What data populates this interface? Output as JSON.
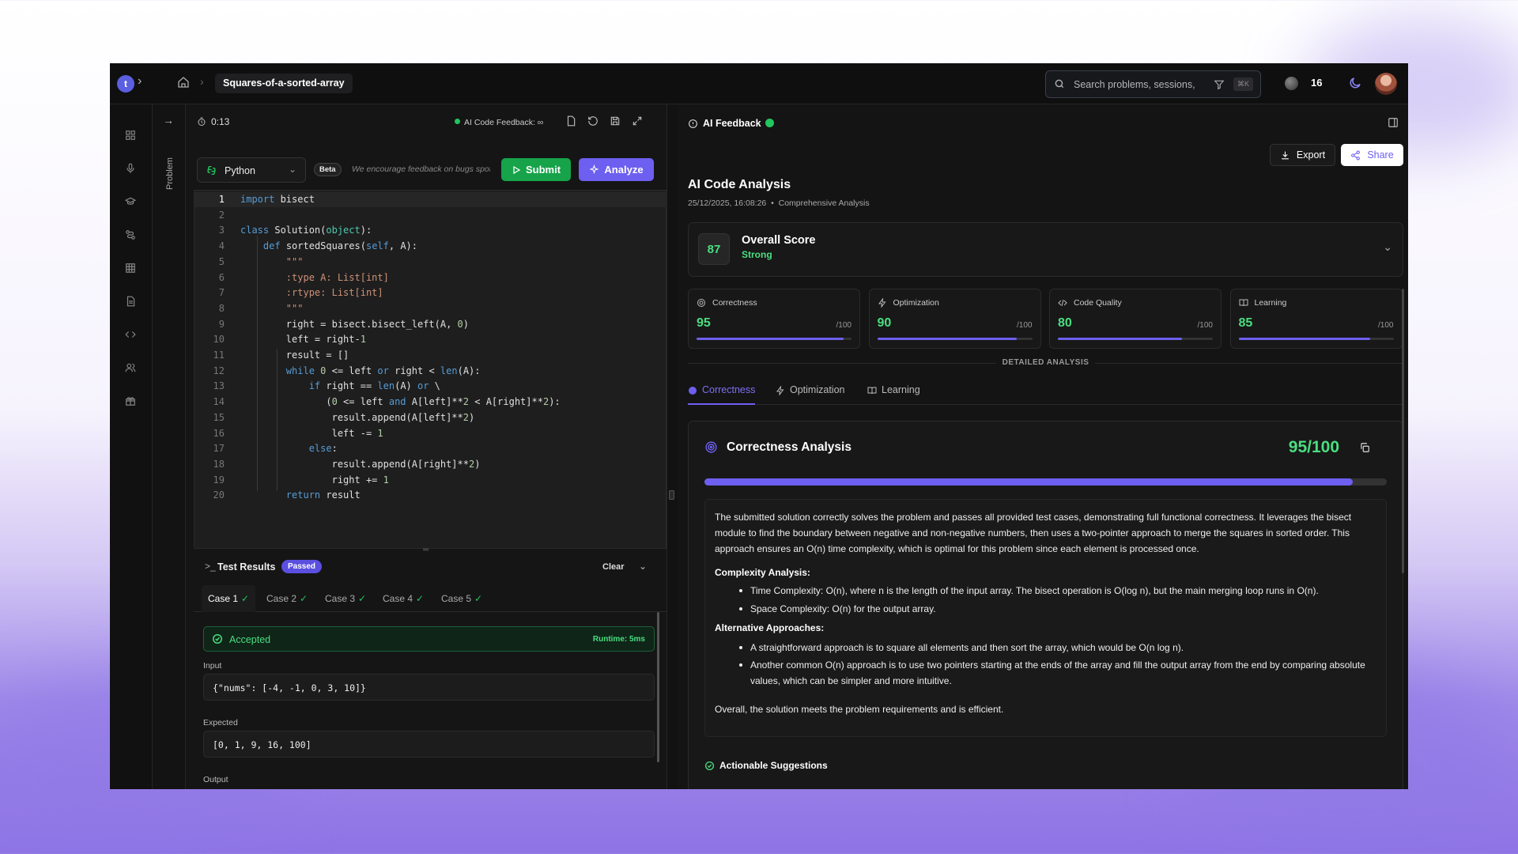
{
  "colors": {
    "accent": "#6d5ff0",
    "success": "#22c55e",
    "success_text": "#4ade80",
    "bg": "#141414"
  },
  "topbar": {
    "logo_letter": "t",
    "breadcrumb_current": "Squares-of-a-sorted-array",
    "search_placeholder": "Search problems, sessions,",
    "search_shortcut": "⌘K",
    "coins": "16"
  },
  "problem_strip": {
    "label": "Problem"
  },
  "editor": {
    "timer": "0:13",
    "ai_feedback_label": "AI Code Feedback: ∞",
    "language": "Python",
    "beta_badge": "Beta",
    "feedback_note": "We encourage feedback on bugs spotted",
    "submit_label": "Submit",
    "analyze_label": "Analyze",
    "code_lines": [
      {
        "n": "1",
        "html": "<span class='kw'>import</span> bisect"
      },
      {
        "n": "2",
        "html": ""
      },
      {
        "n": "3",
        "html": "<span class='kw'>class</span> Solution(<span class='bi'>object</span>):"
      },
      {
        "n": "4",
        "html": "    <span class='kw'>def</span> sortedSquares(<span class='kw'>self</span>, A):"
      },
      {
        "n": "5",
        "html": "        <span class='str'>\"\"\"</span>"
      },
      {
        "n": "6",
        "html": "        <span class='str'>:type A: List[int]</span>"
      },
      {
        "n": "7",
        "html": "        <span class='str'>:rtype: List[int]</span>"
      },
      {
        "n": "8",
        "html": "        <span class='str'>\"\"\"</span>"
      },
      {
        "n": "9",
        "html": "        right = bisect.bisect_left(A, <span class='num'>0</span>)"
      },
      {
        "n": "10",
        "html": "        left = right-<span class='num'>1</span>"
      },
      {
        "n": "11",
        "html": "        result = []"
      },
      {
        "n": "12",
        "html": "        <span class='kw'>while</span> <span class='num'>0</span> &lt;= left <span class='kw'>or</span> right &lt; <span class='kw'>len</span>(A):"
      },
      {
        "n": "13",
        "html": "            <span class='kw'>if</span> right == <span class='kw'>len</span>(A) <span class='kw'>or</span> \\"
      },
      {
        "n": "14",
        "html": "               (<span class='num'>0</span> &lt;= left <span class='kw'>and</span> A[left]**<span class='num'>2</span> &lt; A[right]**<span class='num'>2</span>):"
      },
      {
        "n": "15",
        "html": "                result.append(A[left]**<span class='num'>2</span>)"
      },
      {
        "n": "16",
        "html": "                left -= <span class='num'>1</span>"
      },
      {
        "n": "17",
        "html": "            <span class='kw'>else</span>:"
      },
      {
        "n": "18",
        "html": "                result.append(A[right]**<span class='num'>2</span>)"
      },
      {
        "n": "19",
        "html": "                right += <span class='num'>1</span>"
      },
      {
        "n": "20",
        "html": "        <span class='kw'>return</span> result"
      }
    ]
  },
  "tests": {
    "title": "Test Results",
    "status_badge": "Passed",
    "clear_label": "Clear",
    "cases": [
      "Case 1",
      "Case 2",
      "Case 3",
      "Case 4",
      "Case 5"
    ],
    "result": "Accepted",
    "runtime": "Runtime: 5ms",
    "input_label": "Input",
    "input_value": "{\"nums\": [-4, -1, 0, 3, 10]}",
    "expected_label": "Expected",
    "expected_value": "[0, 1, 9, 16, 100]",
    "output_label": "Output"
  },
  "feedback": {
    "panel_title": "AI Feedback",
    "export_label": "Export",
    "share_label": "Share",
    "analysis_title": "AI Code Analysis",
    "timestamp": "25/12/2025, 16:08:26",
    "analysis_type": "Comprehensive Analysis",
    "overall_score": "87",
    "overall_title": "Overall Score",
    "overall_rating": "Strong",
    "metrics": [
      {
        "name": "Correctness",
        "value": "95",
        "max": "/100",
        "fraction": 0.95
      },
      {
        "name": "Optimization",
        "value": "90",
        "max": "/100",
        "fraction": 0.9
      },
      {
        "name": "Code Quality",
        "value": "80",
        "max": "/100",
        "fraction": 0.8
      },
      {
        "name": "Learning",
        "value": "85",
        "max": "/100",
        "fraction": 0.85
      }
    ],
    "detailed_label": "DETAILED ANALYSIS",
    "tabs": [
      "Correctness",
      "Optimization",
      "Learning"
    ],
    "detail_title": "Correctness Analysis",
    "detail_score": "95/100",
    "detail_fraction": 0.95,
    "summary": "The submitted solution correctly solves the problem and passes all provided test cases, demonstrating full functional correctness. It leverages the bisect module to find the boundary between negative and non-negative numbers, then uses a two-pointer approach to merge the squares in sorted order. This approach ensures an O(n) time complexity, which is optimal for this problem since each element is processed once.",
    "complexity_heading": "Complexity Analysis:",
    "complexity_items": [
      "Time Complexity: O(n), where n is the length of the input array. The bisect operation is O(log n), but the main merging loop runs in O(n).",
      "Space Complexity: O(n) for the output array."
    ],
    "alternatives_heading": "Alternative Approaches:",
    "alternatives_items": [
      "A straightforward approach is to square all elements and then sort the array, which would be O(n log n).",
      "Another common O(n) approach is to use two pointers starting at the ends of the array and fill the output array from the end by comparing absolute values, which can be simpler and more intuitive."
    ],
    "conclusion": "Overall, the solution meets the problem requirements and is efficient.",
    "suggestions_heading": "Actionable Suggestions"
  }
}
